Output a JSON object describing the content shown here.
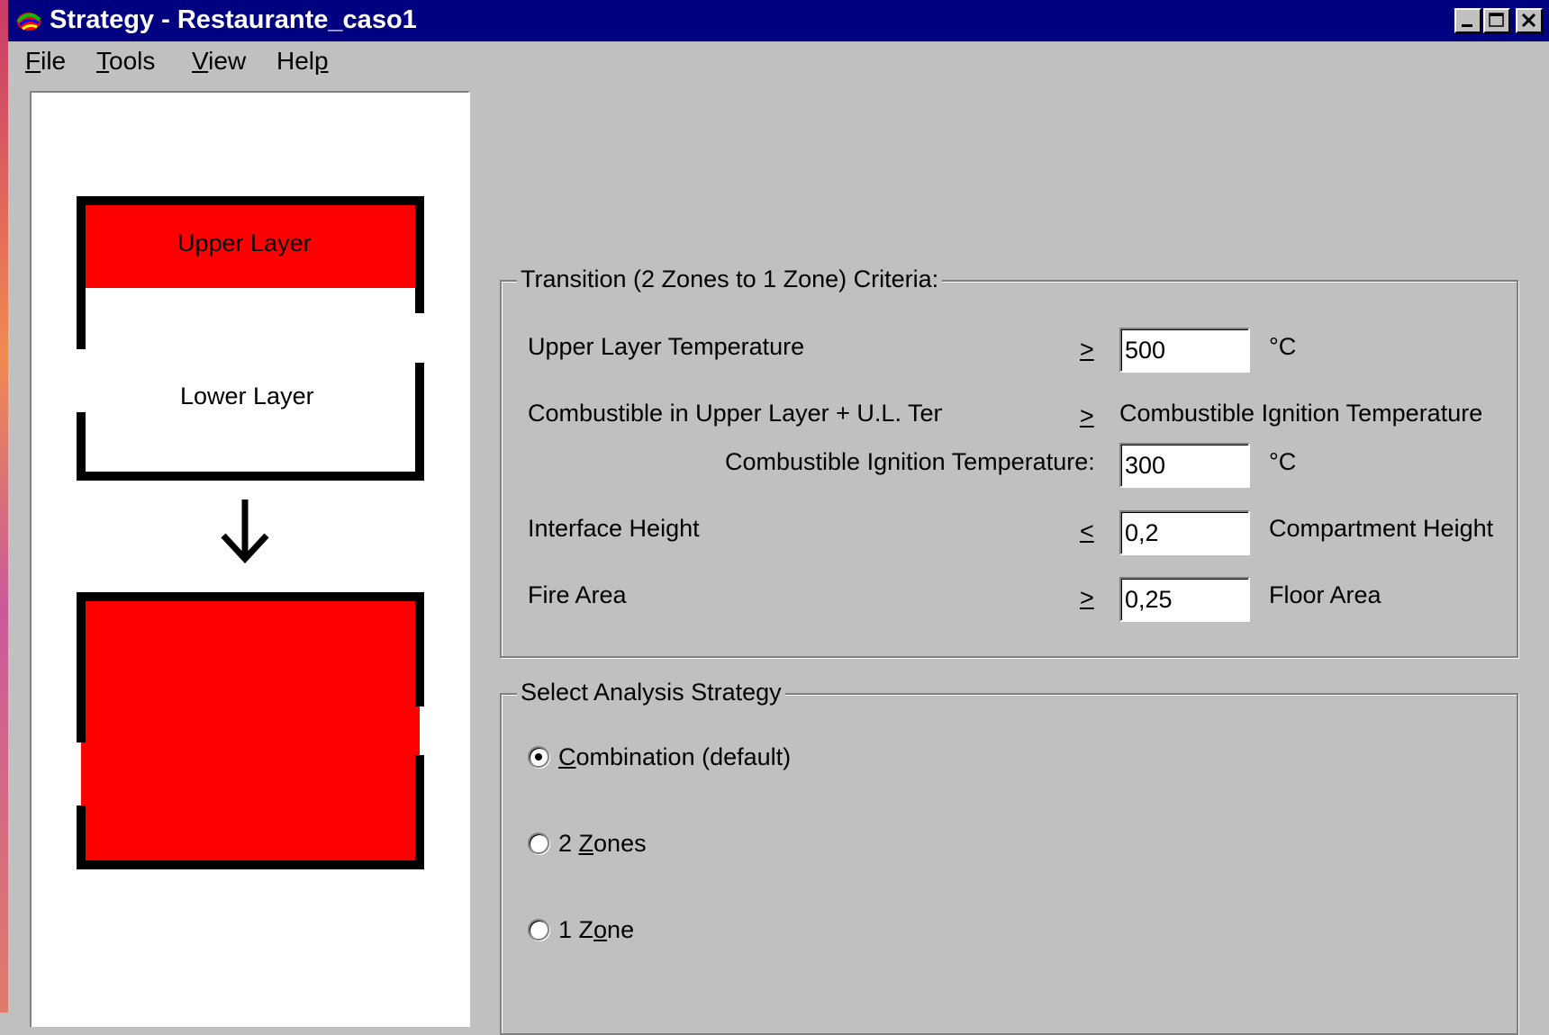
{
  "window": {
    "title": "Strategy - Restaurante_caso1",
    "controls": [
      "minimize",
      "maximize",
      "close"
    ]
  },
  "menu": {
    "items": [
      {
        "pre": "",
        "key": "F",
        "post": "ile"
      },
      {
        "pre": "",
        "key": "T",
        "post": "ools"
      },
      {
        "pre": "",
        "key": "V",
        "post": "iew"
      },
      {
        "pre": "Hel",
        "key": "p",
        "post": ""
      }
    ]
  },
  "diagram": {
    "upper_layer_label": "Upper Layer",
    "lower_layer_label": "Lower Layer",
    "arrow_icon": "arrow-down-icon",
    "fill_color": "#ff0000"
  },
  "transition": {
    "title": "Transition (2 Zones to 1 Zone) Criteria:",
    "upper_temp": {
      "label": "Upper Layer Temperature",
      "operator": ">",
      "value": "500",
      "unit": "°C"
    },
    "combustible": {
      "label": "Combustible in Upper Layer + U.L. Temperature",
      "operator": ">",
      "target": "Combustible Ignition Temperature"
    },
    "ignition": {
      "label": "Combustible Ignition Temperature:",
      "value": "300",
      "unit": "°C"
    },
    "interface": {
      "label": "Interface Height",
      "operator": "<",
      "value": "0,2",
      "unit": "Compartment Height"
    },
    "fire_area": {
      "label": "Fire Area",
      "operator": ">",
      "value": "0,25",
      "unit": "Floor Area"
    }
  },
  "strategy": {
    "title": "Select Analysis Strategy",
    "options": [
      {
        "pre": "",
        "key": "C",
        "post": "ombination (default)",
        "selected": true
      },
      {
        "pre": "2 ",
        "key": "Z",
        "post": "ones",
        "selected": false
      },
      {
        "pre": "1 Z",
        "key": "o",
        "post": "ne",
        "selected": false
      }
    ]
  }
}
